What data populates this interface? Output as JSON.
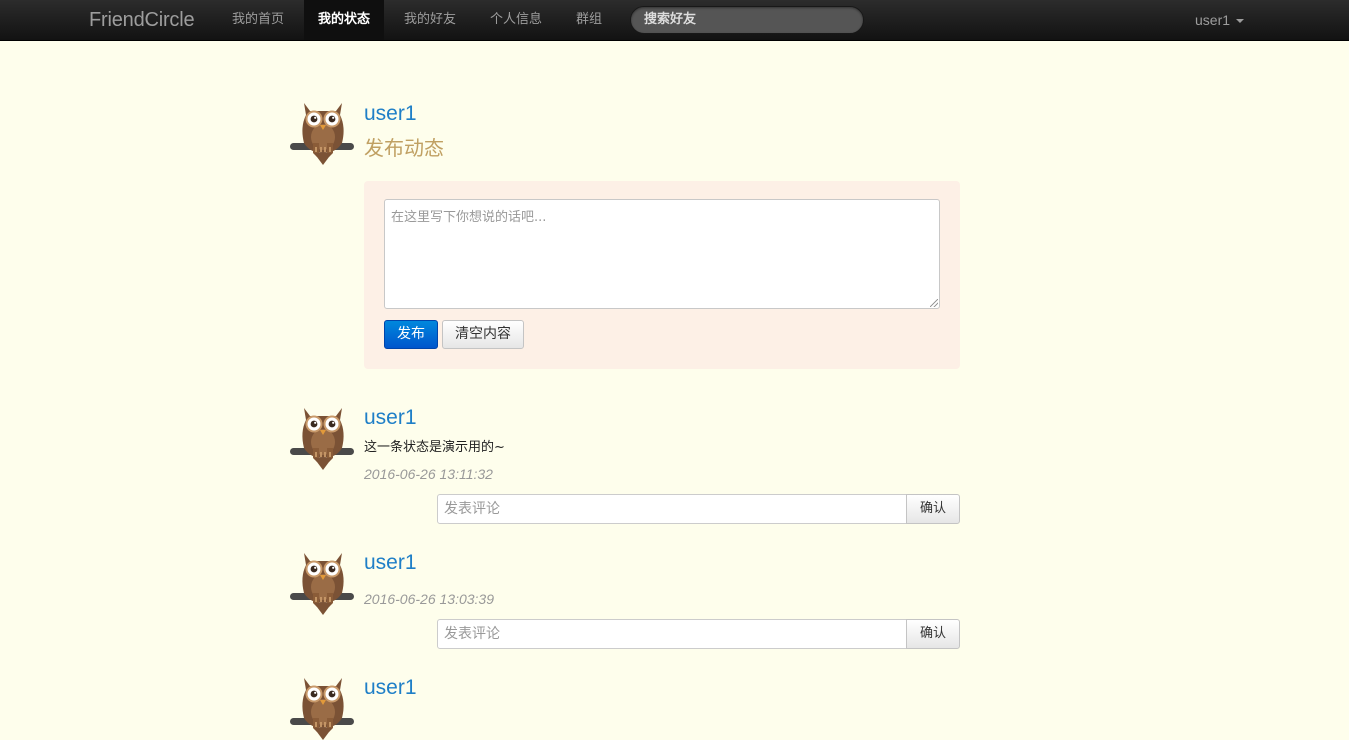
{
  "navbar": {
    "brand": "FriendCircle",
    "items": [
      {
        "label": "我的首页"
      },
      {
        "label": "我的状态",
        "active": true
      },
      {
        "label": "我的好友"
      },
      {
        "label": "个人信息"
      },
      {
        "label": "群组"
      }
    ],
    "search_placeholder": "搜索好友",
    "user": "user1"
  },
  "publish": {
    "username": "user1",
    "title": "发布动态",
    "textarea_placeholder": "在这里写下你想说的话吧...",
    "submit_label": "发布",
    "clear_label": "清空内容"
  },
  "posts": [
    {
      "username": "user1",
      "content": "这一条状态是演示用的~",
      "time": "2016-06-26 13:11:32",
      "comment_placeholder": "发表评论",
      "confirm_label": "确认"
    },
    {
      "username": "user1",
      "content": "",
      "time": "2016-06-26 13:03:39",
      "comment_placeholder": "发表评论",
      "confirm_label": "确认"
    },
    {
      "username": "user1"
    }
  ],
  "colors": {
    "page_background": "#fefeec",
    "username": "#1f7fc7",
    "publish_title": "#c0a062",
    "publish_panel": "#fdf0e6",
    "primary_button": "#0066cc",
    "navbar": "#1b1b1b"
  },
  "icons": {
    "avatar": "owl-icon",
    "dropdown": "caret-down-icon",
    "textarea_resize": "resize-grip-icon"
  }
}
